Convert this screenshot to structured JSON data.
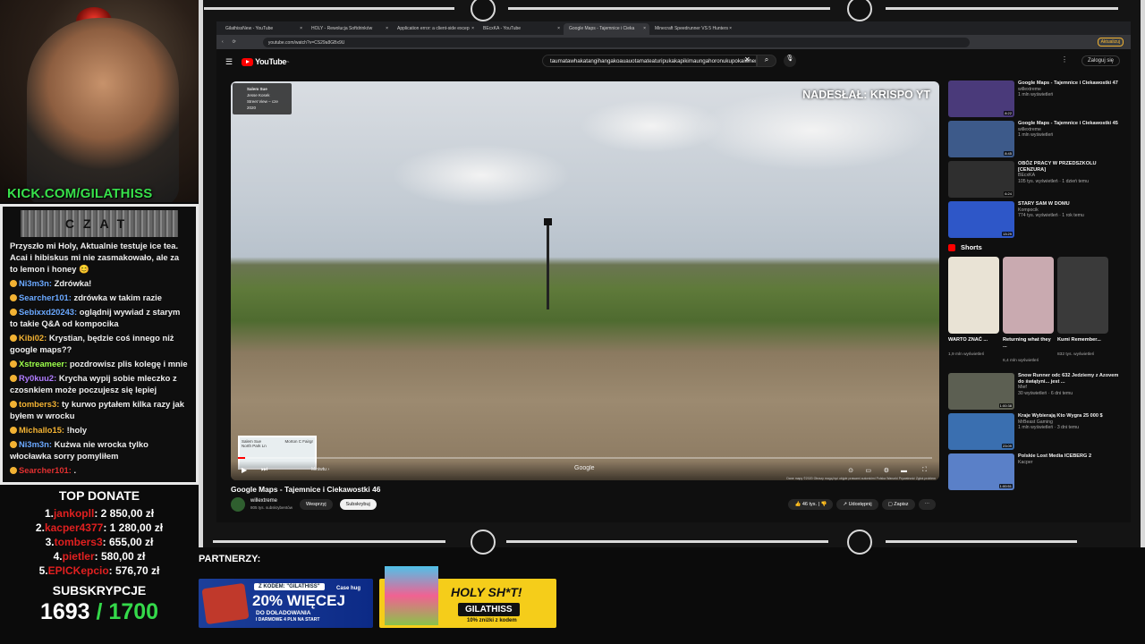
{
  "overlay": {
    "kick_url": "KICK.COM/GILATHISS",
    "chat_title": "CZAT",
    "chat": [
      {
        "user": "",
        "text": "Przyszło mi Holy, Aktualnie testuje ice tea. Acai i hibiskus mi nie zasmakowało, ale za to lemon i honey 😊",
        "color": "#f1f1f1"
      },
      {
        "user": "Ni3m3n:",
        "text": "Zdrówka!",
        "color": "#6aa8ff"
      },
      {
        "user": "Searcher101:",
        "text": "zdrówka w takim razie",
        "color": "#6aa8ff"
      },
      {
        "user": "Sebixxd20243:",
        "text": "oglądnij wywiad z starym to takie Q&A od kompocika",
        "color": "#6aa8ff"
      },
      {
        "user": "Kibi02:",
        "text": "Krystian, będzie coś innego niż google maps??",
        "color": "#f2b233"
      },
      {
        "user": "Xstreameer:",
        "text": "pozdrowisz plis kolegę i mnie",
        "color": "#9cff4a"
      },
      {
        "user": "Ry0kuu2:",
        "text": "Krycha wypij sobie mleczko z czosnkiem może poczujesz się lepiej",
        "color": "#b07cff"
      },
      {
        "user": "tombers3:",
        "text": "ty kurwo pytałem kilka razy jak byłem w wrocku",
        "color": "#f2b233"
      },
      {
        "user": "Michallo15:",
        "text": "!holy",
        "color": "#f2b233"
      },
      {
        "user": "Ni3m3n:",
        "text": "Kużwa nie wrocka tylko włocławka sorry pomyliłem",
        "color": "#6aa8ff"
      },
      {
        "user": "Searcher101:",
        "text": ".",
        "color": "#e03030"
      }
    ],
    "top_donate_title": "TOP DONATE",
    "donations": [
      {
        "rank": "1.",
        "name": "jankopll",
        "amount": "2 850,00 zł"
      },
      {
        "rank": "2.",
        "name": "kacper4377",
        "amount": "1 280,00 zł"
      },
      {
        "rank": "3.",
        "name": "tombers3",
        "amount": "655,00 zł"
      },
      {
        "rank": "4.",
        "name": "pietler",
        "amount": "580,00 zł"
      },
      {
        "rank": "5.",
        "name": "EPICKepcio",
        "amount": "576,70 zł"
      }
    ],
    "subs_title": "SUBSKRYPCJE",
    "subs_current": "1693",
    "subs_goal": "/ 1700",
    "partners_label": "PARTNERZY:",
    "ad1": {
      "tag": "Z KODEM: \"GILATHISS\"",
      "big": "20% WIĘCEJ",
      "line1": "DO DOŁADOWANIA",
      "line2": "I DARMOWE 4 PLN NA START",
      "brand": "Case\nhug"
    },
    "ad2": {
      "headline": "HOLY SH*T!",
      "code": "GILATHISS",
      "sub": "10% zniżki z kodem"
    }
  },
  "browser": {
    "tabs": [
      {
        "label": "GilathissNew - YouTube"
      },
      {
        "label": "HOLY - Rewolucja Softdrinków"
      },
      {
        "label": "Application error: a client-side excep"
      },
      {
        "label": "BEcxKA - YouTube"
      },
      {
        "label": "Google Maps - Tajemnice i Cieka"
      },
      {
        "label": "Minecraft Speedrunner VS 5 Hunters"
      }
    ],
    "url": "youtube.com/watch?v=CS29a8GBx9U",
    "update_label": "Aktualizuj"
  },
  "youtube": {
    "logo": "YouTube",
    "logo_sup": "PL",
    "search_value": "taumatawhakatangihangakoauauotamateaturipukakapikimaungahoronukupokaiwhenuakitanatahu",
    "signin": "Zaloguj się",
    "video": {
      "overlay_text": "NADESŁAŁ: KRISPO YT",
      "sv_place": "Salem Sue",
      "sv_author": "Jesse Kosek",
      "sv_date": "Street View – cze 2020",
      "map_place": "Salem Sue",
      "map_side": "Morton C Fairgr",
      "map_street": "North Park Ln",
      "mute": "Miniwtu ›",
      "google": "Google",
      "attribution": "Dane mapy ©2020   Obrazy mogą być objęte prawami autorskimi   Polska   Warunki   Prywatność   Zgłoś problem",
      "progress": 0.01,
      "title": "Google Maps - Tajemnice i Ciekawostki 46",
      "channel": "willextreme",
      "subs": "805 tys. subskrybentów",
      "support": "Wesprzyj",
      "subscribe": "Subskrybuj",
      "likes": "46 tys.",
      "share": "Udostępnij",
      "save": "Zapisz"
    },
    "recommended": [
      {
        "title": "Google Maps - Tajemnice i Ciekawostki 47",
        "channel": "willextreme",
        "meta": "1 mln wyświetleń",
        "dur": "8:22",
        "color": "#4a3a7a"
      },
      {
        "title": "Google Maps - Tajemnice i Ciekawostki 45",
        "channel": "willextreme",
        "meta": "1 mln wyświetleń",
        "dur": "8:45",
        "color": "#3d5a8a"
      },
      {
        "title": "OBÓZ PRACY W PRZEDSZKOLU [CENZURA]",
        "channel": "BEcxKA",
        "meta": "105 tys. wyświetleń · 1 dzień temu",
        "dur": "6:24",
        "color": "#2f2f2f"
      },
      {
        "title": "STARY SAM W DOMU",
        "channel": "Kompocik",
        "meta": "774 tys. wyświetleń · 1 rok temu",
        "dur": "13:29",
        "color": "#2e57c8"
      }
    ],
    "shorts_label": "Shorts",
    "shorts": [
      {
        "title": "WARTO ZNAĆ ...",
        "views": "1,9 mln wyświetleń",
        "color": "#e9e3d5"
      },
      {
        "title": "Returning what they ...",
        "views": "6,4 mln wyświetleń",
        "color": "#c9aab0"
      },
      {
        "title": "Kumi Remember...",
        "views": "832 tys. wyświetleń",
        "color": "#3a3a3a"
      }
    ],
    "recommended2": [
      {
        "title": "Snow Runner odc 632 Jedziemy z Azovem do świątyni... jest ...",
        "channel": "Mief",
        "meta": "30 wyświetleń · 6 dni temu",
        "dur": "1:00:38",
        "color": "#5c5f52"
      },
      {
        "title": "Kraje Wybierają Kto Wygra 25 000 $",
        "channel": "MrBeast Gaming",
        "meta": "1 mln wyświetleń · 3 dni temu",
        "dur": "23:09",
        "color": "#3a6fb0"
      },
      {
        "title": "Polskie Lost Media ICEBERG 2",
        "channel": "Kacper",
        "meta": "",
        "dur": "1:00:51",
        "color": "#5a80c8"
      }
    ]
  }
}
